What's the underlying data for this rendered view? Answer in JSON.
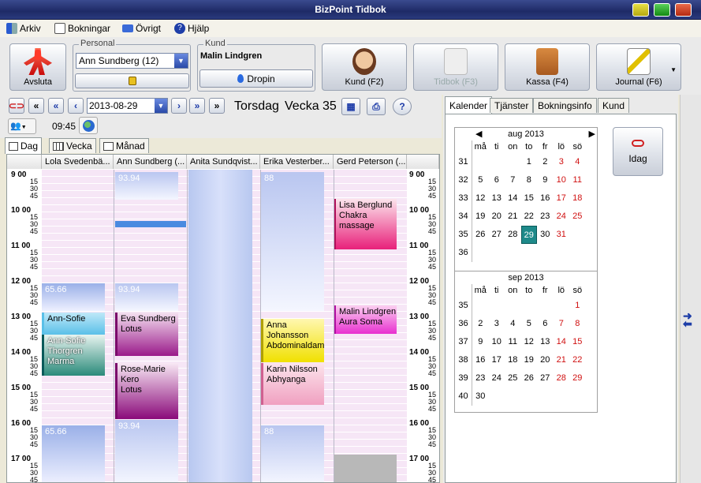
{
  "window": {
    "title": "BizPoint Tidbok"
  },
  "menu": [
    {
      "label": "Arkiv",
      "icon": "exit-icon"
    },
    {
      "label": "Bokningar",
      "icon": "calendar-icon"
    },
    {
      "label": "Övrigt",
      "icon": "box-icon"
    },
    {
      "label": "Hjälp",
      "icon": "help-icon"
    }
  ],
  "toolbar": {
    "quit_label": "Avsluta",
    "personal_group": "Personal",
    "personal_value": "Ann Sundberg (12)",
    "lock_icon": "lock-icon",
    "kund_group": "Kund",
    "kund_value": "Malin Lindgren",
    "dropin_label": "Dropin",
    "kund_btn": "Kund (F2)",
    "tidbok_btn": "Tidbok (F3)",
    "kassa_btn": "Kassa (F4)",
    "journal_btn": "Journal (F6)"
  },
  "nav": {
    "date": "2013-08-29",
    "day": "Torsdag",
    "week": "Vecka 35",
    "time": "09:45"
  },
  "view_tabs": [
    "Dag",
    "Vecka",
    "Månad"
  ],
  "columns": [
    "Lola Svedenbä...",
    "Ann Sundberg (...",
    "Anita Sundqvist...",
    "Erika Vesterber...",
    "Gerd Peterson (..."
  ],
  "hours": [
    "9",
    "10",
    "11",
    "12",
    "13",
    "14",
    "15",
    "16",
    "17"
  ],
  "quarter_labels": [
    "00",
    "15",
    "30",
    "45"
  ],
  "bookings": {
    "gerd_1": "Lisa Berglund\nChakra\nmassage",
    "gerd_2": "Malin Lindgren\nAura Soma",
    "erika_1": "Anna\nJohansson\nAbdominaldam",
    "erika_2": "Karin Nilsson\nAbhyanga",
    "ann_1": "Eva Sundberg\nLotus",
    "ann_2": "Rose-Marie\nKero\nLotus",
    "lola_1": "Ann-Sofie",
    "lola_2": "Ann-Sofie\nThorgren\nMarma",
    "lola_free_1": "65.66",
    "lola_free_2": "65.66",
    "ann_free_1": "93.94",
    "ann_free_2": "93.94",
    "ann_free_3": "93.94",
    "erika_free_1": "88",
    "erika_free_2": "88"
  },
  "right_tabs": [
    "Kalender",
    "Tjänster",
    "Bokningsinfo",
    "Kund"
  ],
  "idag_label": "Idag",
  "weekday_headers": [
    "må",
    "ti",
    "on",
    "to",
    "fr",
    "lö",
    "sö"
  ],
  "cal_aug": {
    "title": "aug 2013",
    "weeks": [
      {
        "wk": "31",
        "days": [
          "",
          "",
          "",
          "1",
          "2",
          "3",
          "4"
        ]
      },
      {
        "wk": "32",
        "days": [
          "5",
          "6",
          "7",
          "8",
          "9",
          "10",
          "11"
        ]
      },
      {
        "wk": "33",
        "days": [
          "12",
          "13",
          "14",
          "15",
          "16",
          "17",
          "18"
        ]
      },
      {
        "wk": "34",
        "days": [
          "19",
          "20",
          "21",
          "22",
          "23",
          "24",
          "25"
        ]
      },
      {
        "wk": "35",
        "days": [
          "26",
          "27",
          "28",
          "29",
          "30",
          "31",
          ""
        ]
      },
      {
        "wk": "36",
        "days": [
          "",
          "",
          "",
          "",
          "",
          "",
          ""
        ]
      }
    ],
    "selected": "29"
  },
  "cal_sep": {
    "title": "sep 2013",
    "weeks": [
      {
        "wk": "35",
        "days": [
          "",
          "",
          "",
          "",
          "",
          "",
          "1"
        ]
      },
      {
        "wk": "36",
        "days": [
          "2",
          "3",
          "4",
          "5",
          "6",
          "7",
          "8"
        ]
      },
      {
        "wk": "37",
        "days": [
          "9",
          "10",
          "11",
          "12",
          "13",
          "14",
          "15"
        ]
      },
      {
        "wk": "38",
        "days": [
          "16",
          "17",
          "18",
          "19",
          "20",
          "21",
          "22"
        ]
      },
      {
        "wk": "39",
        "days": [
          "23",
          "24",
          "25",
          "26",
          "27",
          "28",
          "29"
        ]
      },
      {
        "wk": "40",
        "days": [
          "30",
          "",
          "",
          "",
          "",
          "",
          ""
        ]
      }
    ]
  },
  "colors": {
    "today": "#1e8a8a",
    "weekend": "#d01010",
    "accent": "#1e2a66"
  }
}
